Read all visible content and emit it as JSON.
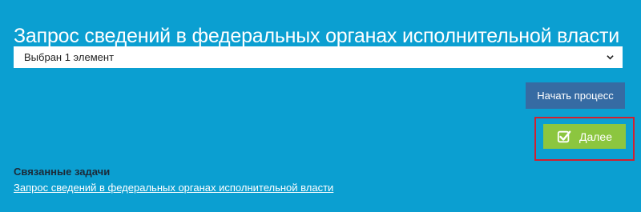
{
  "page": {
    "title": "Запрос сведений в федеральных органах исполнительной власти"
  },
  "selector": {
    "value": "Выбран 1 элемент",
    "icon": "chevron-down-icon"
  },
  "actions": {
    "start_process_label": "Начать процесс",
    "next_label": "Далее",
    "next_icon": "checkbox-check-icon"
  },
  "related": {
    "heading": "Связанные задачи",
    "link_text": "Запрос сведений в федеральных органах исполнительной власти"
  },
  "colors": {
    "background": "#0b9fd1",
    "start_button": "#366ba3",
    "next_button": "#8cc63f",
    "highlight_border": "#d1202f"
  }
}
